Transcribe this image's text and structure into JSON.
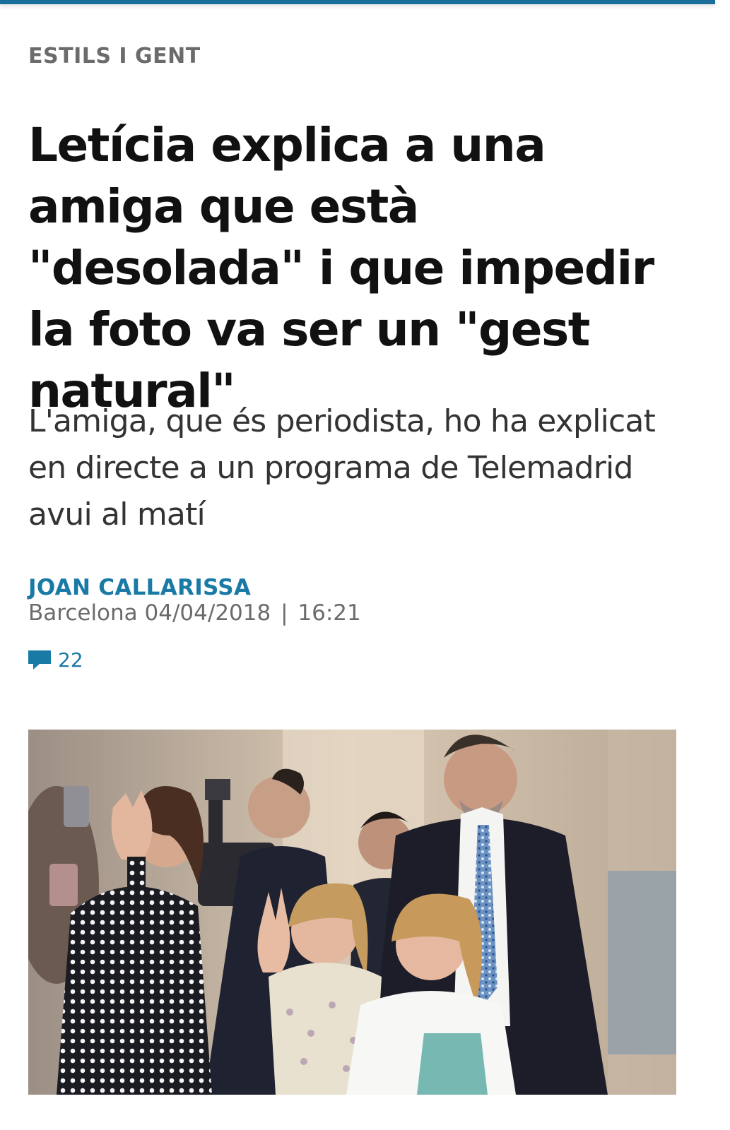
{
  "article": {
    "section": "ESTILS I GENT",
    "headline": "Letícia explica a una amiga que està \"desolada\" i que impedir la foto va ser un \"gest natural\"",
    "subtitle": "L'amiga, que és periodista, ho ha explicat en directe a un programa de Telemadrid avui al matí",
    "author": "JOAN CALLARISSA",
    "location": "Barcelona",
    "date": "04/04/2018",
    "separator": "|",
    "time": "16:21",
    "comments": {
      "icon": "comment-bubble-icon",
      "count": "22"
    }
  },
  "colors": {
    "accent": "#1a7aa6",
    "top_rule": "#1a6e9a",
    "meta_gray": "#6b6b6b",
    "headline": "#111111"
  }
}
